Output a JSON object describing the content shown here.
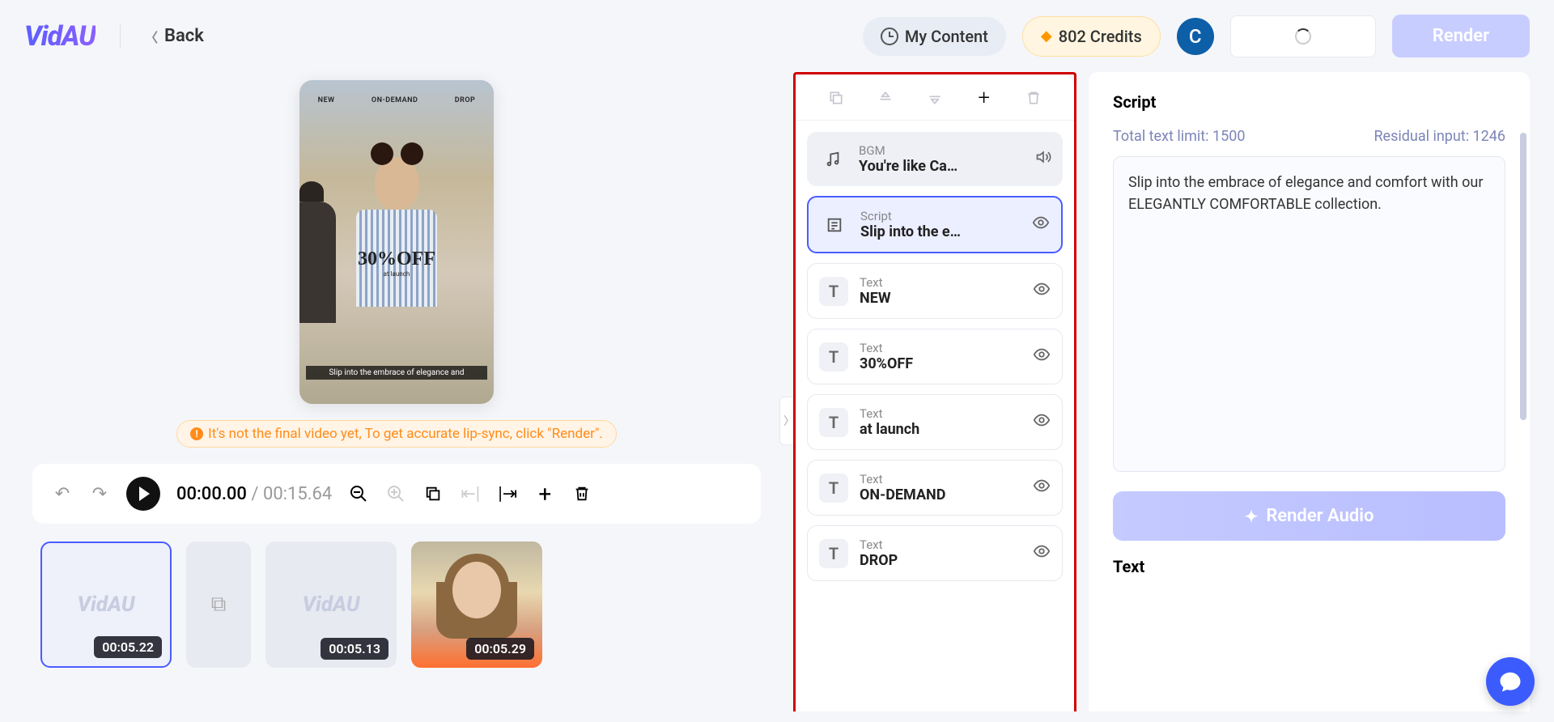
{
  "header": {
    "logo": "VidAU",
    "back": "Back",
    "my_content": "My Content",
    "credits": "802 Credits",
    "avatar_initial": "C",
    "render": "Render"
  },
  "preview": {
    "tags": [
      "NEW",
      "ON-DEMAND",
      "DROP"
    ],
    "offer": "30%OFF",
    "offer_sub": "at launch",
    "caption": "Slip into the embrace of elegance and",
    "notice": "It's not the final video yet, To get accurate lip-sync, click \"Render\".",
    "time_current": "00:00.00",
    "time_total": "00:15.64",
    "clips": [
      {
        "duration": "00:05.22",
        "type": "wm"
      },
      {
        "duration": "",
        "type": "flip"
      },
      {
        "duration": "00:05.13",
        "type": "wm"
      },
      {
        "duration": "00:05.29",
        "type": "photo"
      }
    ]
  },
  "elements": [
    {
      "type": "BGM",
      "title": "You're like Ca…",
      "icon": "music",
      "kind": "bgm",
      "action": "speaker"
    },
    {
      "type": "Script",
      "title": "Slip into the e…",
      "icon": "script",
      "kind": "selected",
      "action": "eye"
    },
    {
      "type": "Text",
      "title": "NEW",
      "icon": "T",
      "kind": "text",
      "action": "eye"
    },
    {
      "type": "Text",
      "title": "30%OFF",
      "icon": "T",
      "kind": "text",
      "action": "eye"
    },
    {
      "type": "Text",
      "title": "at launch",
      "icon": "T",
      "kind": "text",
      "action": "eye"
    },
    {
      "type": "Text",
      "title": "ON-DEMAND",
      "icon": "T",
      "kind": "text",
      "action": "eye"
    },
    {
      "type": "Text",
      "title": "DROP",
      "icon": "T",
      "kind": "text",
      "action": "eye"
    }
  ],
  "script_panel": {
    "title": "Script",
    "limit_label": "Total text limit: 1500",
    "residual_label": "Residual input: 1246",
    "content": "Slip into the embrace of elegance and comfort with our ELEGANTLY COMFORTABLE collection.",
    "render_audio": "Render Audio",
    "text_title": "Text"
  }
}
